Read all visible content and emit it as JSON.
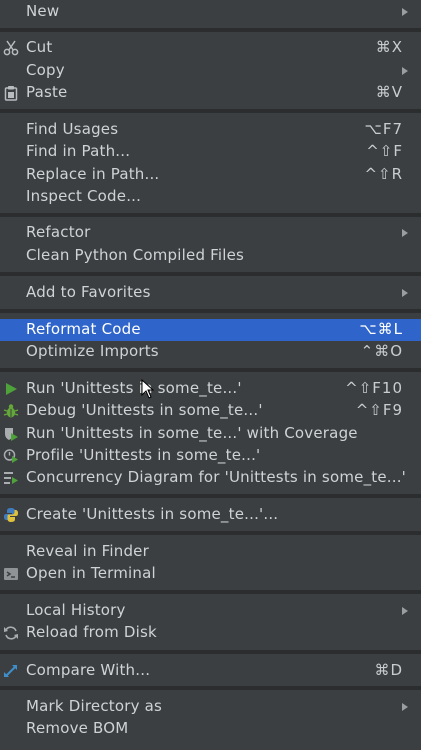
{
  "menu": {
    "new_label": "New",
    "cut_label": "Cut",
    "cut_shortcut": "⌘X",
    "copy_label": "Copy",
    "paste_label": "Paste",
    "paste_shortcut": "⌘V",
    "find_usages_label": "Find Usages",
    "find_usages_shortcut": "⌥F7",
    "find_in_path_label": "Find in Path...",
    "find_in_path_shortcut": "^⇧F",
    "replace_in_path_label": "Replace in Path...",
    "replace_in_path_shortcut": "^⇧R",
    "inspect_code_label": "Inspect Code...",
    "refactor_label": "Refactor",
    "clean_python_label": "Clean Python Compiled Files",
    "add_to_favorites_label": "Add to Favorites",
    "reformat_code_label": "Reformat Code",
    "reformat_code_shortcut": "⌥⌘L",
    "optimize_imports_label": "Optimize Imports",
    "optimize_imports_shortcut": "⌃⌘O",
    "run_label": "Run 'Unittests in some_te...'",
    "run_shortcut": "^⇧F10",
    "debug_label": "Debug 'Unittests in some_te...'",
    "debug_shortcut": "^⇧F9",
    "run_coverage_label": "Run 'Unittests in some_te...' with Coverage",
    "profile_label": "Profile 'Unittests in some_te...'",
    "concurrency_label": "Concurrency Diagram for 'Unittests in some_te...'",
    "create_label": "Create 'Unittests in some_te...'...",
    "reveal_label": "Reveal in Finder",
    "open_terminal_label": "Open in Terminal",
    "local_history_label": "Local History",
    "reload_label": "Reload from Disk",
    "compare_label": "Compare With...",
    "compare_shortcut": "⌘D",
    "mark_directory_label": "Mark Directory as",
    "remove_bom_label": "Remove BOM"
  },
  "colors": {
    "background": "#3c3f41",
    "selection": "#2f65ca",
    "separator": "#2b2d2f",
    "run_green": "#4ea23a",
    "debug_green": "#65a83a",
    "compare_blue": "#3f8ec9"
  },
  "icons": {
    "cut": "scissors-icon",
    "paste": "clipboard-icon",
    "run": "play-icon",
    "debug": "bug-icon",
    "coverage": "shield-run-icon",
    "profile": "clock-run-icon",
    "concurrency": "concurrency-icon",
    "create": "python-icon",
    "terminal": "terminal-icon",
    "reload": "refresh-icon",
    "compare": "compare-arrows-icon",
    "submenu": "chevron-right-icon"
  }
}
